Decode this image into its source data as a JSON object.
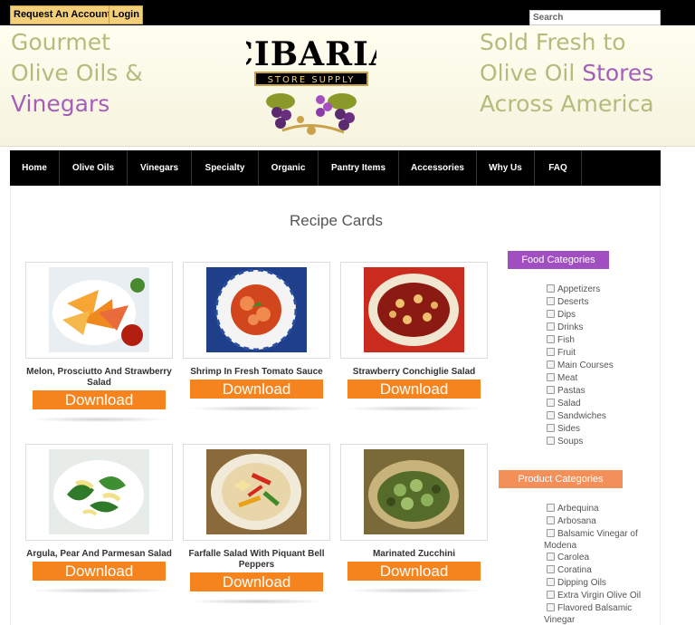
{
  "topbar": {
    "request_account": "Request An Account",
    "login": "Login",
    "search_placeholder": "Search"
  },
  "banner": {
    "left_line1": "Gourmet",
    "left_line2": "Olive Oils &",
    "left_line3": "Vinegars",
    "right_line1": "Sold Fresh to",
    "right_line2a": "Olive Oil ",
    "right_line2b": "Stores",
    "right_line3": "Across America",
    "logo_text": "CIBARIA",
    "logo_sub": "STORE SUPPLY",
    "colors": {
      "olive": "#b3bc7c",
      "purple": "#a55fb9"
    }
  },
  "nav": [
    "Home",
    "Olive Oils",
    "Vinegars",
    "Specialty",
    "Organic",
    "Pantry Items",
    "Accessories",
    "Why Us",
    "FAQ"
  ],
  "page": {
    "title": "Recipe Cards"
  },
  "cards": [
    {
      "title": "Melon, Prosciutto And Strawberry Salad",
      "button": "Download",
      "image": "melon-salad-photo"
    },
    {
      "title": "Shrimp In Fresh Tomato Sauce",
      "button": "Download",
      "image": "shrimp-plate-photo"
    },
    {
      "title": "Strawberry Conchiglie Salad",
      "button": "Download",
      "image": "conchiglie-salad-photo"
    },
    {
      "title": "Argula, Pear And Parmesan Salad",
      "button": "Download",
      "image": "arugula-pear-photo"
    },
    {
      "title": "Farfalle Salad With Piquant Bell Peppers",
      "button": "Download",
      "image": "farfalle-salad-photo"
    },
    {
      "title": "Marinated Zucchini",
      "button": "Download",
      "image": "zucchini-photo"
    }
  ],
  "sidebar": {
    "food_heading": "Food Categories",
    "food_color": "#a14fc0",
    "food": [
      "Appetizers",
      "Deserts",
      "Dips",
      "Drinks",
      "Fish",
      "Fruit",
      "Main Courses",
      "Meat",
      "Pastas",
      "Salad",
      "Sandwiches",
      "Sides",
      "Soups"
    ],
    "product_heading": "Product Categories",
    "product_color": "#f39059",
    "product": [
      "Arbequina",
      "Arbosana",
      "Balsamic Vinegar of Modena",
      "Carolea",
      "Coratina",
      "Dipping Oils",
      "Extra Virgin Olive Oil",
      "Flavored Balsamic Vinegar"
    ]
  },
  "accent_button_color": "#f5841f"
}
